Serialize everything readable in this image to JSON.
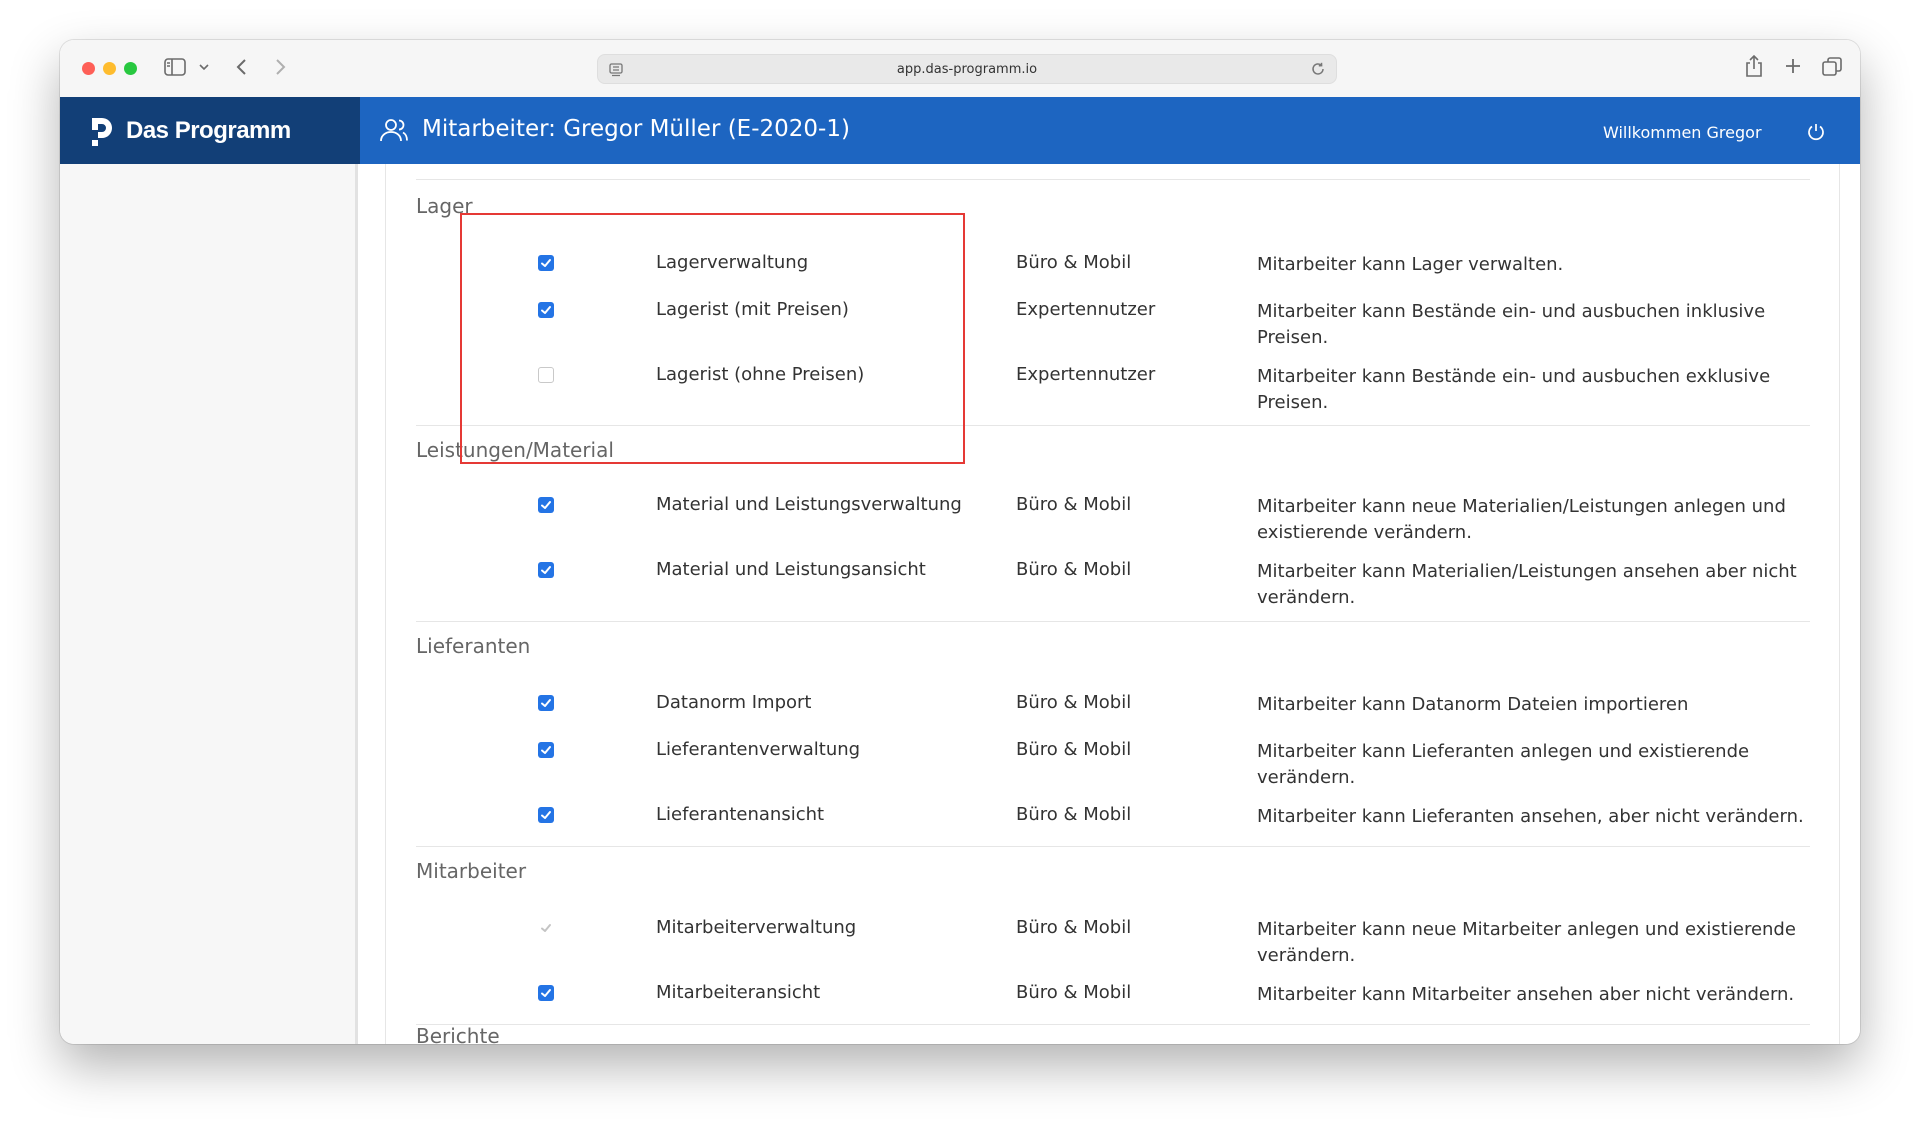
{
  "browser": {
    "url": "app.das-programm.io"
  },
  "app": {
    "logo_text": "Das Programm",
    "page_title": "Mitarbeiter: Gregor Müller (E-2020-1)",
    "welcome": "Willkommen Gregor"
  },
  "colors": {
    "header_blue": "#1d65c1",
    "logo_dark_blue": "#123f77",
    "checkbox_blue": "#2474e5",
    "highlight_red": "#e53935"
  },
  "sections": [
    {
      "title": "Lager",
      "rows": [
        {
          "state": "checked",
          "name": "Lagerverwaltung",
          "platform": "Büro & Mobil",
          "description": "Mitarbeiter kann Lager verwalten."
        },
        {
          "state": "checked",
          "name": "Lagerist (mit Preisen)",
          "platform": "Expertennutzer",
          "description": "Mitarbeiter kann Bestände ein- und ausbuchen inklusive Preisen."
        },
        {
          "state": "unchecked",
          "name": "Lagerist (ohne Preisen)",
          "platform": "Expertennutzer",
          "description": "Mitarbeiter kann Bestände ein- und ausbuchen exklusive Preisen."
        }
      ]
    },
    {
      "title": "Leistungen/Material",
      "rows": [
        {
          "state": "checked",
          "name": "Material und Leistungsverwaltung",
          "platform": "Büro & Mobil",
          "description": "Mitarbeiter kann neue Materialien/Leistungen anlegen und existierende verändern."
        },
        {
          "state": "checked",
          "name": "Material und Leistungsansicht",
          "platform": "Büro & Mobil",
          "description": "Mitarbeiter kann Materialien/Leistungen ansehen aber nicht verändern."
        }
      ]
    },
    {
      "title": "Lieferanten",
      "rows": [
        {
          "state": "checked",
          "name": "Datanorm Import",
          "platform": "Büro & Mobil",
          "description": "Mitarbeiter kann Datanorm Dateien importieren"
        },
        {
          "state": "checked",
          "name": "Lieferantenverwaltung",
          "platform": "Büro & Mobil",
          "description": "Mitarbeiter kann Lieferanten anlegen und existierende verändern."
        },
        {
          "state": "checked",
          "name": "Lieferantenansicht",
          "platform": "Büro & Mobil",
          "description": "Mitarbeiter kann Lieferanten ansehen, aber nicht verändern."
        }
      ]
    },
    {
      "title": "Mitarbeiter",
      "rows": [
        {
          "state": "disabled-checked",
          "name": "Mitarbeiterverwaltung",
          "platform": "Büro & Mobil",
          "description": "Mitarbeiter kann neue Mitarbeiter anlegen und existierende verändern."
        },
        {
          "state": "checked",
          "name": "Mitarbeiteransicht",
          "platform": "Büro & Mobil",
          "description": "Mitarbeiter kann Mitarbeiter ansehen aber nicht verändern."
        }
      ]
    }
  ],
  "next_section_cut": "Berichte"
}
